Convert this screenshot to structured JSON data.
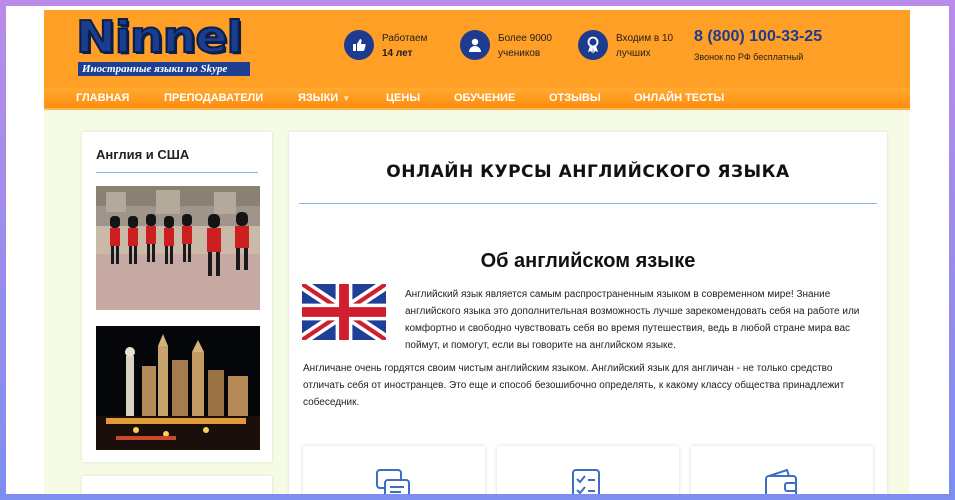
{
  "logo": {
    "name": "Ninnel",
    "tagline": "Иностранные языки по Skype"
  },
  "stats": [
    {
      "line1": "Работаем",
      "line2": "14 лет",
      "icon": "thumbs-up-icon"
    },
    {
      "line1": "Более 9000",
      "line2": "учеников",
      "icon": "user-icon"
    },
    {
      "line1": "Входим в 10",
      "line2": "лучших",
      "icon": "award-icon"
    }
  ],
  "contact": {
    "phone": "8 (800) 100-33-25",
    "note": "Звонок по РФ бесплатный"
  },
  "nav": {
    "items": [
      "ГЛАВНАЯ",
      "ПРЕПОДАВАТЕЛИ",
      "ЯЗЫКИ",
      "ЦЕНЫ",
      "ОБУЧЕНИЕ",
      "ОТЗЫВЫ",
      "ОНЛАЙН ТЕСТЫ"
    ]
  },
  "sidebar": {
    "title": "Англия и США",
    "photos": [
      "guards-photo",
      "las-vegas-photo"
    ]
  },
  "main": {
    "title": "ОНЛАЙН КУРСЫ АНГЛИЙСКОГО ЯЗЫКА",
    "subtitle": "Об английском языке",
    "para1": "Английский язык является самым распространенным языком в современном мире! Знание английского языка это дополнительная возможность лучше зарекомендовать себя на работе или комфортно и свободно чувствовать себя во время путешествия, ведь в любой стране мира вас поймут, и помогут, если вы говорите на английском языке.",
    "para2": "Англичане очень гордятся своим чистым английским языком. Английский язык для англичан - не только средство отличать себя от иностранцев. Это еще и способ безошибочно определять, к какому классу общества принадлежит собеседник.",
    "features": [
      "chat-icon",
      "checklist-icon",
      "wallet-icon"
    ]
  },
  "colors": {
    "header": "#ff9f26",
    "brand_blue": "#1d3c8f",
    "page_bg": "#f6fbe6",
    "divider": "#8fb5e3"
  }
}
